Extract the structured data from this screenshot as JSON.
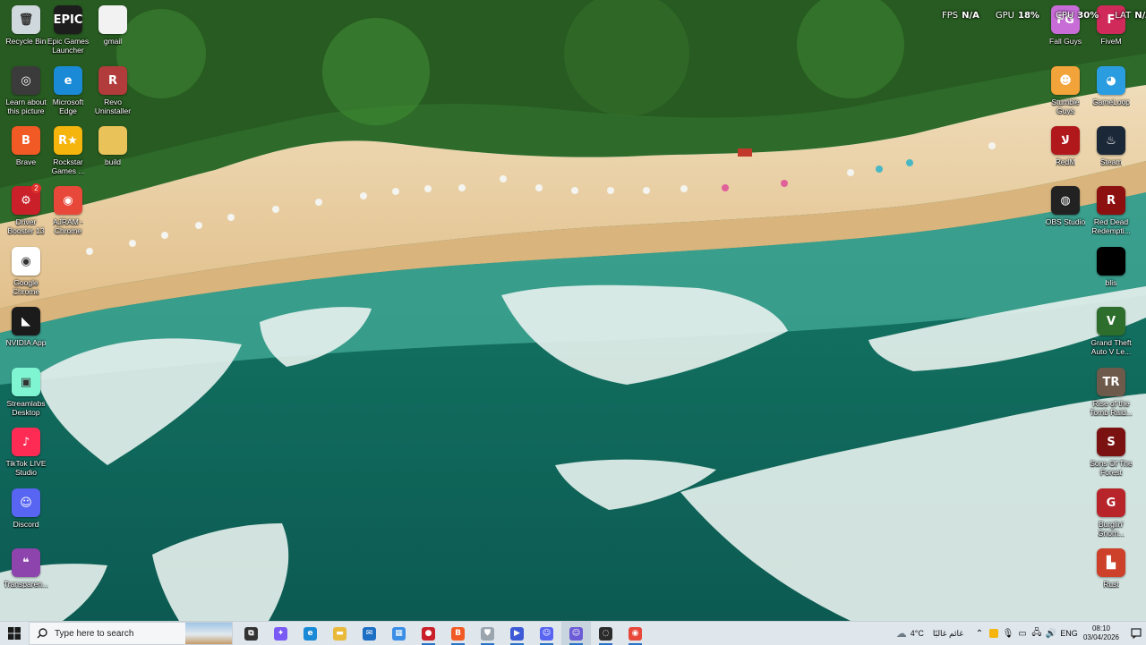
{
  "desktop": {
    "icons_left": [
      {
        "label": "Recycle Bin",
        "icon": "recycle-bin-icon",
        "color": "#cfd8dc",
        "glyph": "🗑"
      },
      {
        "label": "Epic Games\nLauncher",
        "icon": "epic-games-icon",
        "color": "#1d1d1d",
        "glyph": "EPIC"
      },
      {
        "label": "gmail",
        "icon": "text-file-icon",
        "color": "#f2f2f2",
        "glyph": ""
      },
      {
        "label": "Learn about\nthis picture",
        "icon": "spotlight-icon",
        "color": "#3b3b3b",
        "glyph": "◎"
      },
      {
        "label": "Microsoft\nEdge",
        "icon": "edge-icon",
        "color": "#1a8ad6",
        "glyph": "e"
      },
      {
        "label": "Revo\nUninstaller",
        "icon": "revo-uninstaller-icon",
        "color": "#b23b3b",
        "glyph": "R"
      },
      {
        "label": "Brave",
        "icon": "brave-icon",
        "color": "#f15a24",
        "glyph": "B"
      },
      {
        "label": "Rockstar\nGames ...",
        "icon": "rockstar-icon",
        "color": "#f5b50c",
        "glyph": "R★"
      },
      {
        "label": "build",
        "icon": "folder-icon",
        "color": "#e9c25a",
        "glyph": ""
      },
      {
        "label": "Driver\nBooster 13",
        "icon": "driver-booster-icon",
        "color": "#c9202a",
        "glyph": "⚙"
      },
      {
        "label": "AJRAM -\nChrome",
        "icon": "chrome-profile-icon",
        "color": "#e8483a",
        "glyph": "◉"
      },
      {
        "label": "Google\nChrome",
        "icon": "chrome-icon",
        "color": "#ffffff",
        "glyph": "◉"
      },
      {
        "label": "NVIDIA App",
        "icon": "nvidia-icon",
        "color": "#1b1b1b",
        "glyph": "◣"
      },
      {
        "label": "Streamlabs\nDesktop",
        "icon": "streamlabs-icon",
        "color": "#80f5d2",
        "glyph": "▣"
      },
      {
        "label": "TikTok LIVE\nStudio",
        "icon": "tiktok-icon",
        "color": "#fe2c55",
        "glyph": "♪"
      },
      {
        "label": "Discord",
        "icon": "discord-icon",
        "color": "#5865f2",
        "glyph": "☺"
      },
      {
        "label": "Transparen...",
        "icon": "transparent-chat-icon",
        "color": "#8e44ad",
        "glyph": "❝"
      }
    ],
    "icons_right": [
      {
        "label": "Fall Guys",
        "icon": "fall-guys-icon",
        "color": "#c86dd7",
        "glyph": "FG"
      },
      {
        "label": "FiveM",
        "icon": "fivem-icon",
        "color": "#d02a5b",
        "glyph": "F"
      },
      {
        "label": "Stumble\nGuys",
        "icon": "stumble-guys-icon",
        "color": "#f2a33a",
        "glyph": "☻"
      },
      {
        "label": "GameLoop",
        "icon": "gameloop-icon",
        "color": "#2a9de0",
        "glyph": "◕"
      },
      {
        "label": "RedM",
        "icon": "redm-icon",
        "color": "#b0181c",
        "glyph": "ﻻ"
      },
      {
        "label": "Steam",
        "icon": "steam-icon",
        "color": "#1b2838",
        "glyph": "♨"
      },
      {
        "label": "OBS Studio",
        "icon": "obs-icon",
        "color": "#222222",
        "glyph": "◍"
      },
      {
        "label": "Red Dead\nRedempti...",
        "icon": "red-dead-icon",
        "color": "#8c1010",
        "glyph": "R"
      },
      {
        "label": "blis",
        "icon": "blis-icon",
        "color": "#000000",
        "glyph": ""
      },
      {
        "label": "Grand Theft\nAuto V Le...",
        "icon": "gta-v-icon",
        "color": "#2d6e2d",
        "glyph": "V"
      },
      {
        "label": "Rise of the\nTomb Raid...",
        "icon": "tomb-raider-icon",
        "color": "#6d5a4a",
        "glyph": "TR"
      },
      {
        "label": "Sons Of The\nForest",
        "icon": "sons-of-the-forest-icon",
        "color": "#7a1212",
        "glyph": "S"
      },
      {
        "label": "Burglin'\nGnom...",
        "icon": "burglin-gnomes-icon",
        "color": "#b7252a",
        "glyph": "G"
      },
      {
        "label": "Rust",
        "icon": "rust-icon",
        "color": "#cd412b",
        "glyph": "▙"
      }
    ],
    "driver_badge": "2"
  },
  "perf_overlay": {
    "fps_label": "FPS",
    "fps_value": "N/A",
    "gpu_label": "GPU",
    "gpu_value": "18%",
    "cpu_label": "CPU",
    "cpu_value": "30%",
    "lat_label": "LAT",
    "lat_value": "N/A"
  },
  "taskbar": {
    "search_placeholder": "Type here to search",
    "pinned": [
      {
        "icon": "task-view-icon",
        "color": "#333333",
        "glyph": "⧉"
      },
      {
        "icon": "copilot-icon",
        "color": "#7a5af5",
        "glyph": "✦"
      },
      {
        "icon": "edge-icon",
        "color": "#1a8ad6",
        "glyph": "e"
      },
      {
        "icon": "file-explorer-icon",
        "color": "#e9b93a",
        "glyph": "▬"
      },
      {
        "icon": "mail-icon",
        "color": "#1d6fc4",
        "glyph": "✉"
      },
      {
        "icon": "microsoft-store-icon",
        "color": "#3a8ee6",
        "glyph": "▦"
      },
      {
        "icon": "recording-icon",
        "color": "#c9202a",
        "glyph": "●"
      },
      {
        "icon": "brave-icon",
        "color": "#f15a24",
        "glyph": "B"
      },
      {
        "icon": "vpn-shield-icon",
        "color": "#9aa5ad",
        "glyph": "⛊"
      },
      {
        "icon": "media-player-icon",
        "color": "#3d5bd6",
        "glyph": "▶"
      },
      {
        "icon": "discord-icon",
        "color": "#5865f2",
        "glyph": "☺"
      },
      {
        "icon": "discord-ptb-icon",
        "color": "#6b5bd6",
        "glyph": "☺"
      },
      {
        "icon": "steam-helper-icon",
        "color": "#2b2b2b",
        "glyph": "◌"
      },
      {
        "icon": "chrome-icon",
        "color": "#e8483a",
        "glyph": "◉"
      }
    ],
    "weather_temp": "4°C",
    "weather_text": "غائم غالبًا",
    "language": "ENG",
    "time": "08:10",
    "date": "03/04/2026"
  }
}
